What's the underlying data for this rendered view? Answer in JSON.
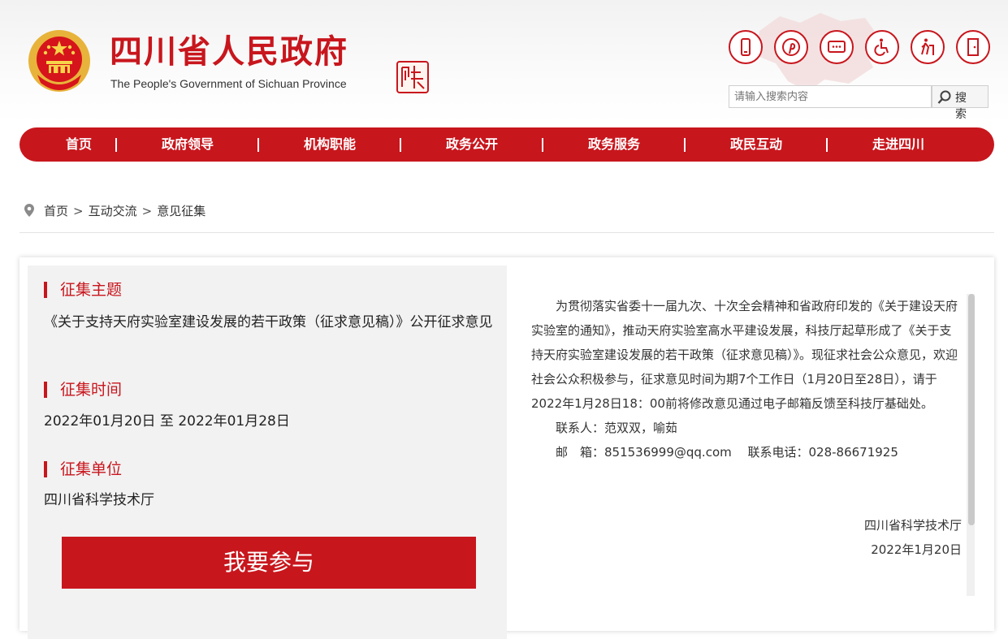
{
  "header": {
    "title": "四川省人民政府",
    "subtitle": "The People's Government of Sichuan Province",
    "seal_text": "四川中國",
    "tool_icons": [
      "mobile-icon",
      "pinterest-icon",
      "message-icon",
      "accessibility-icon",
      "elderly-mode-icon",
      "exit-door-icon"
    ]
  },
  "search": {
    "placeholder": "请输入搜索内容",
    "button_label": "搜 索"
  },
  "nav": {
    "items": [
      "首页",
      "政府领导",
      "机构职能",
      "政务公开",
      "政务服务",
      "政民互动",
      "走进四川"
    ],
    "separator": "|"
  },
  "breadcrumb": {
    "items": [
      "首页",
      "互动交流",
      "意见征集"
    ],
    "separator": ">"
  },
  "collection": {
    "topic_heading": "征集主题",
    "topic_text": "《关于支持天府实验室建设发展的若干政策（征求意见稿）》公开征求意见",
    "time_heading": "征集时间",
    "time_text": "2022年01月20日 至 2022年01月28日",
    "unit_heading": "征集单位",
    "unit_text": "四川省科学技术厅",
    "join_button": "我要参与"
  },
  "notice": {
    "paragraph": "为贯彻落实省委十一届九次、十次全会精神和省政府印发的《关于建设天府实验室的通知》，推动天府实验室高水平建设发展，科技厅起草形成了《关于支持天府实验室建设发展的若干政策（征求意见稿）》。现征求社会公众意见，欢迎社会公众积极参与，征求意见时间为期7个工作日（1月20日至28日），请于2022年1月28日18：00前将修改意见通过电子邮箱反馈至科技厅基础处。",
    "contact_line": "联系人：范双双，喻茹",
    "email_line": "邮　箱：851536999@qq.com　 联系电话：028-86671925",
    "signature": "四川省科学技术厅",
    "date": "2022年1月20日"
  },
  "colors": {
    "brand_red": "#c8161d",
    "panel_gray": "#f2f2f2"
  }
}
